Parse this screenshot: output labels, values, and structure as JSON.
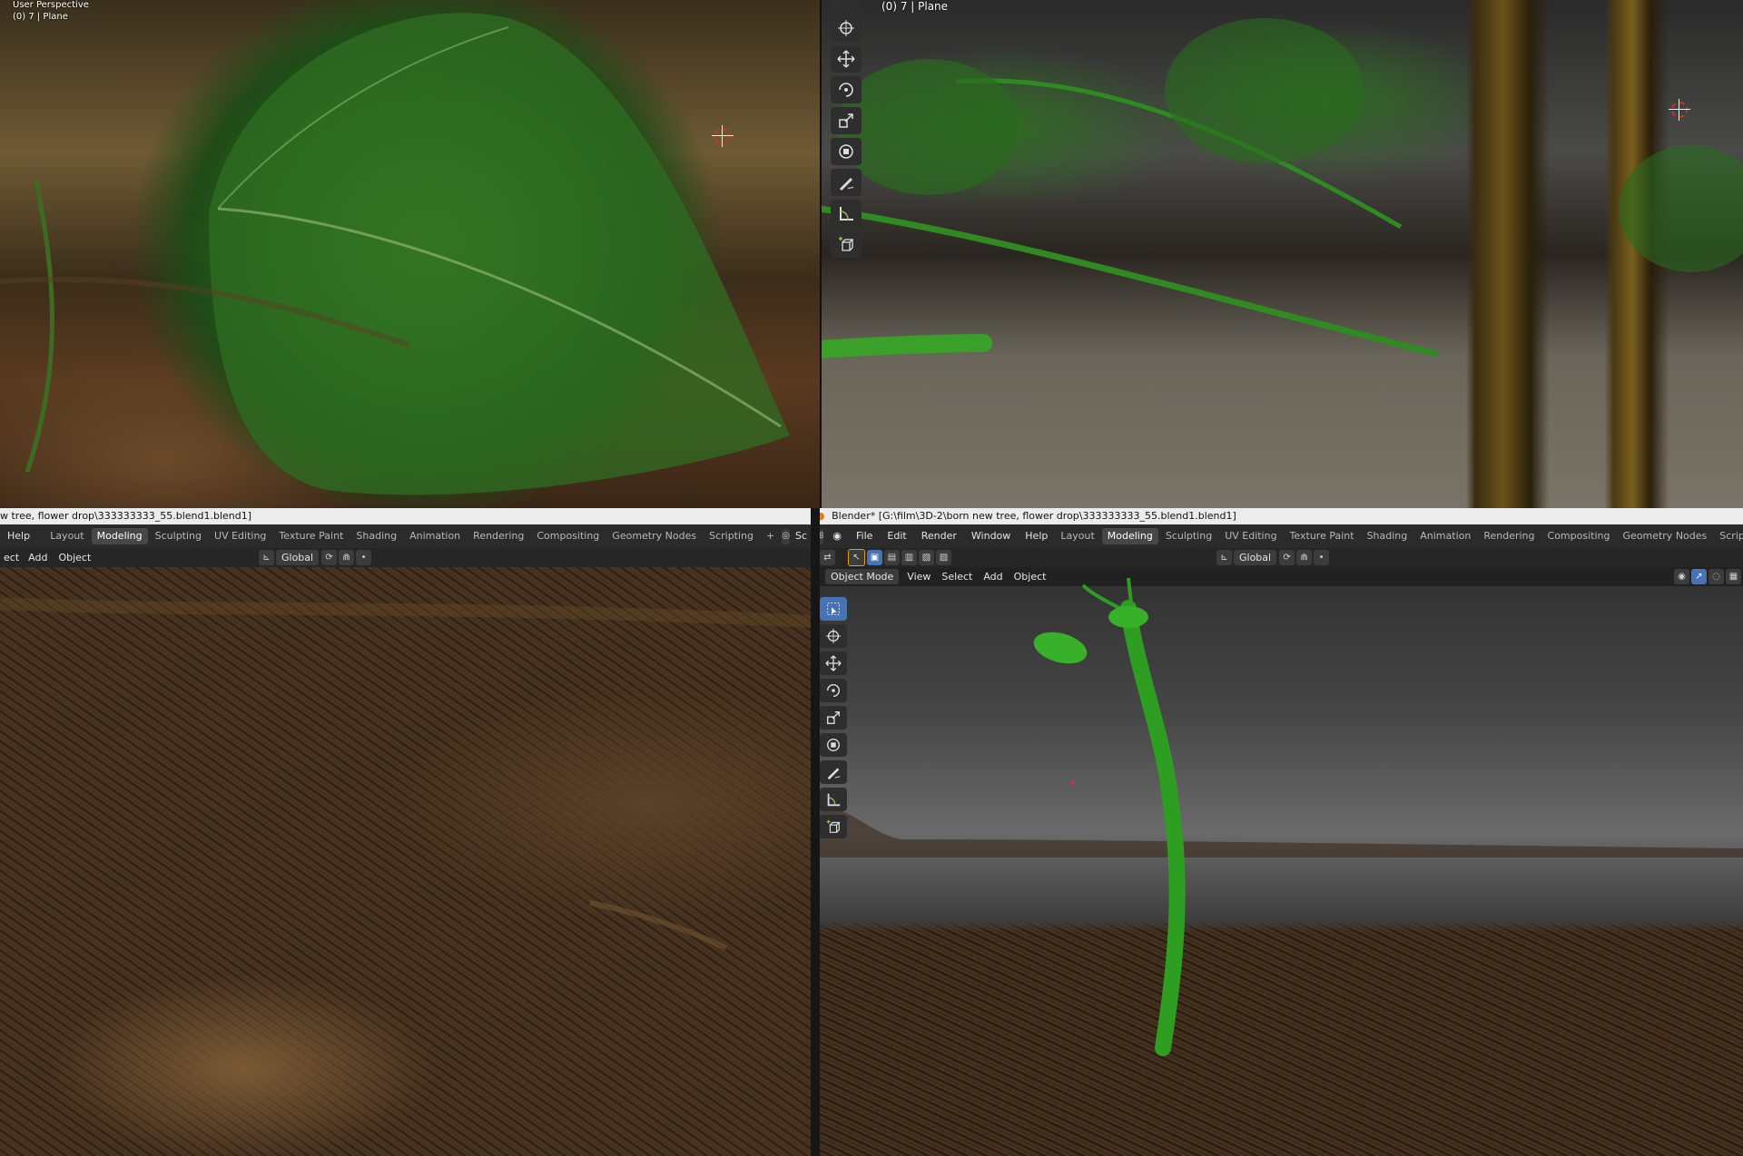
{
  "viewports": {
    "top_left": {
      "perspective_label": "User Perspective",
      "object_label": "(0) 7 | Plane"
    },
    "top_right": {
      "object_label": "(0) 7 | Plane"
    }
  },
  "left_window": {
    "title": "w tree, flower drop\\333333333_55.blend1.blend1]",
    "menu": {
      "help": "Help"
    },
    "tabs": [
      "Layout",
      "Modeling",
      "Sculpting",
      "UV Editing",
      "Texture Paint",
      "Shading",
      "Animation",
      "Rendering",
      "Compositing",
      "Geometry Nodes",
      "Scripting"
    ],
    "active_tab": "Modeling",
    "scene_fragment": "Sc",
    "header": {
      "select_fragment": "ect",
      "add": "Add",
      "object": "Object",
      "orientation": "Global"
    }
  },
  "right_window": {
    "title": "Blender* [G:\\film\\3D-2\\born new tree, flower drop\\333333333_55.blend1.blend1]",
    "menu": [
      "File",
      "Edit",
      "Render",
      "Window",
      "Help"
    ],
    "tabs": [
      "Layout",
      "Modeling",
      "Sculpting",
      "UV Editing",
      "Texture Paint",
      "Shading",
      "Animation",
      "Rendering",
      "Compositing",
      "Geometry Nodes",
      "Scripting"
    ],
    "active_tab": "Modeling",
    "header": {
      "mode": "Object Mode",
      "view": "View",
      "select": "Select",
      "add": "Add",
      "object": "Object",
      "orientation": "Global"
    }
  },
  "icons": [
    "select-box-icon",
    "cursor-icon",
    "move-icon",
    "rotate-icon",
    "scale-icon",
    "transform-icon",
    "annotate-icon",
    "measure-icon",
    "add-cube-icon",
    "blender-logo-icon",
    "plus-icon"
  ],
  "colors": {
    "accent": "#4772b3",
    "active_tab_bg": "#474747",
    "menubar_bg": "#2b2b2b",
    "titlebar_bg": "#ececec"
  }
}
